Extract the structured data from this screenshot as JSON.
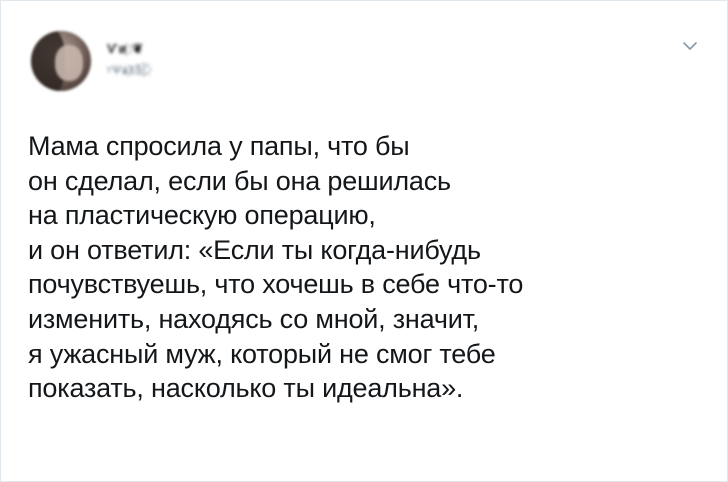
{
  "tweet": {
    "author": {
      "display_name": "Ѵи҉ ❦",
      "handle": "ᵞѰѧ҈ℓℳ҈"
    },
    "menu_icon": "chevron-down-icon",
    "text_lines": [
      "Мама спросила у папы, что бы",
      "он сделал, если бы она решилась",
      "на пластическую операцию,",
      "и он ответил: «Если ты когда-нибудь",
      "почувствуешь, что хочешь в себе что-то",
      "изменить, находясь со мной, значит,",
      "я ужасный муж, который не смог тебе",
      "показать, насколько ты идеальна»."
    ]
  },
  "colors": {
    "text": "#14171a",
    "secondary": "#657786",
    "chevron": "#8899a6",
    "border": "#e1e8ed"
  }
}
